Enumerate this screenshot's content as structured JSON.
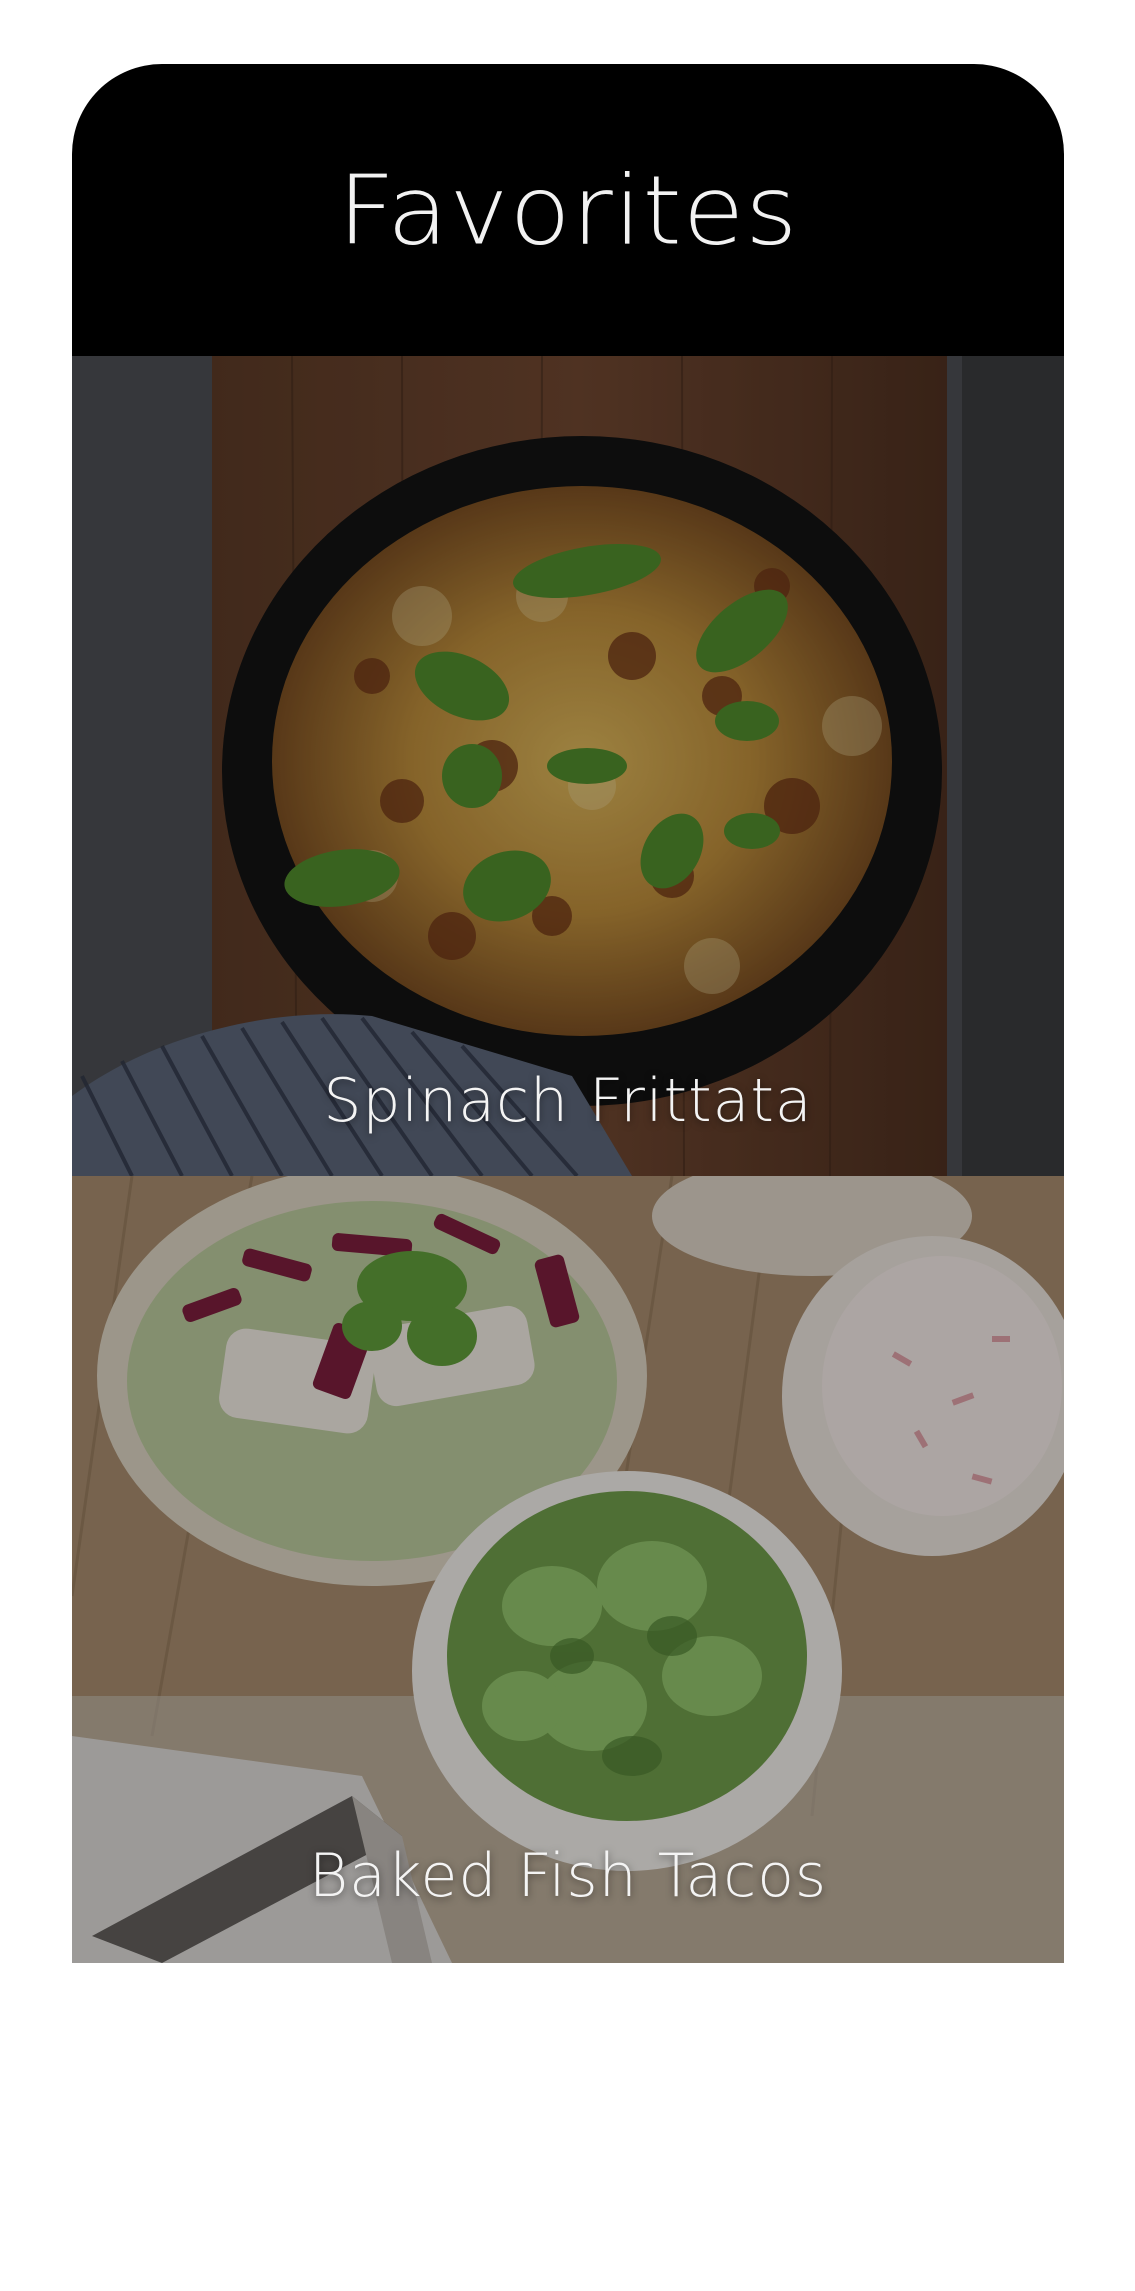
{
  "header": {
    "title": "Favorites"
  },
  "favorites": [
    {
      "name": "Spinach Frittata",
      "image": "spinach-frittata-photo"
    },
    {
      "name": "Baked Fish Tacos",
      "image": "baked-fish-tacos-photo"
    }
  ],
  "colors": {
    "header_bg": "#000000",
    "title_text": "#f2f2f2",
    "page_bg": "#ffffff"
  }
}
